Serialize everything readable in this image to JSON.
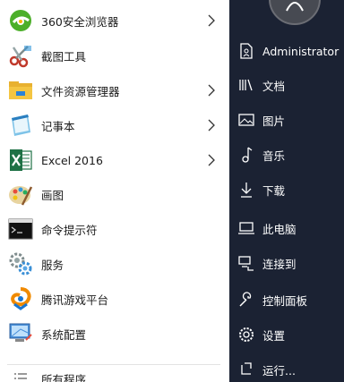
{
  "programs": [
    {
      "label": "360安全浏览器",
      "icon": "360-browser-icon",
      "has_submenu": true
    },
    {
      "label": "截图工具",
      "icon": "snipping-tool-icon",
      "has_submenu": false
    },
    {
      "label": "文件资源管理器",
      "icon": "file-explorer-icon",
      "has_submenu": true
    },
    {
      "label": "记事本",
      "icon": "notepad-icon",
      "has_submenu": true
    },
    {
      "label": "Excel 2016",
      "icon": "excel-icon",
      "has_submenu": true
    },
    {
      "label": "画图",
      "icon": "paint-icon",
      "has_submenu": false
    },
    {
      "label": "命令提示符",
      "icon": "command-prompt-icon",
      "has_submenu": false
    },
    {
      "label": "服务",
      "icon": "services-icon",
      "has_submenu": false
    },
    {
      "label": "腾讯游戏平台",
      "icon": "tencent-game-icon",
      "has_submenu": false
    },
    {
      "label": "系统配置",
      "icon": "system-config-icon",
      "has_submenu": false
    }
  ],
  "all_programs": {
    "label": "所有程序",
    "icon": "all-programs-icon"
  },
  "right_panel": {
    "user": "Administrator",
    "items": [
      {
        "label": "文档",
        "icon": "documents-icon"
      },
      {
        "label": "图片",
        "icon": "pictures-icon"
      },
      {
        "label": "音乐",
        "icon": "music-icon"
      },
      {
        "label": "下载",
        "icon": "downloads-icon"
      },
      {
        "label": "此电脑",
        "icon": "computer-icon"
      },
      {
        "label": "连接到",
        "icon": "connect-to-icon"
      },
      {
        "label": "控制面板",
        "icon": "control-panel-icon"
      },
      {
        "label": "设置",
        "icon": "settings-icon"
      },
      {
        "label": "运行...",
        "icon": "run-icon"
      }
    ]
  },
  "colors": {
    "left_bg": "#ffffff",
    "right_bg": "#1b2233",
    "excel_green": "#1e7145",
    "folder_yellow": "#f4c542"
  }
}
